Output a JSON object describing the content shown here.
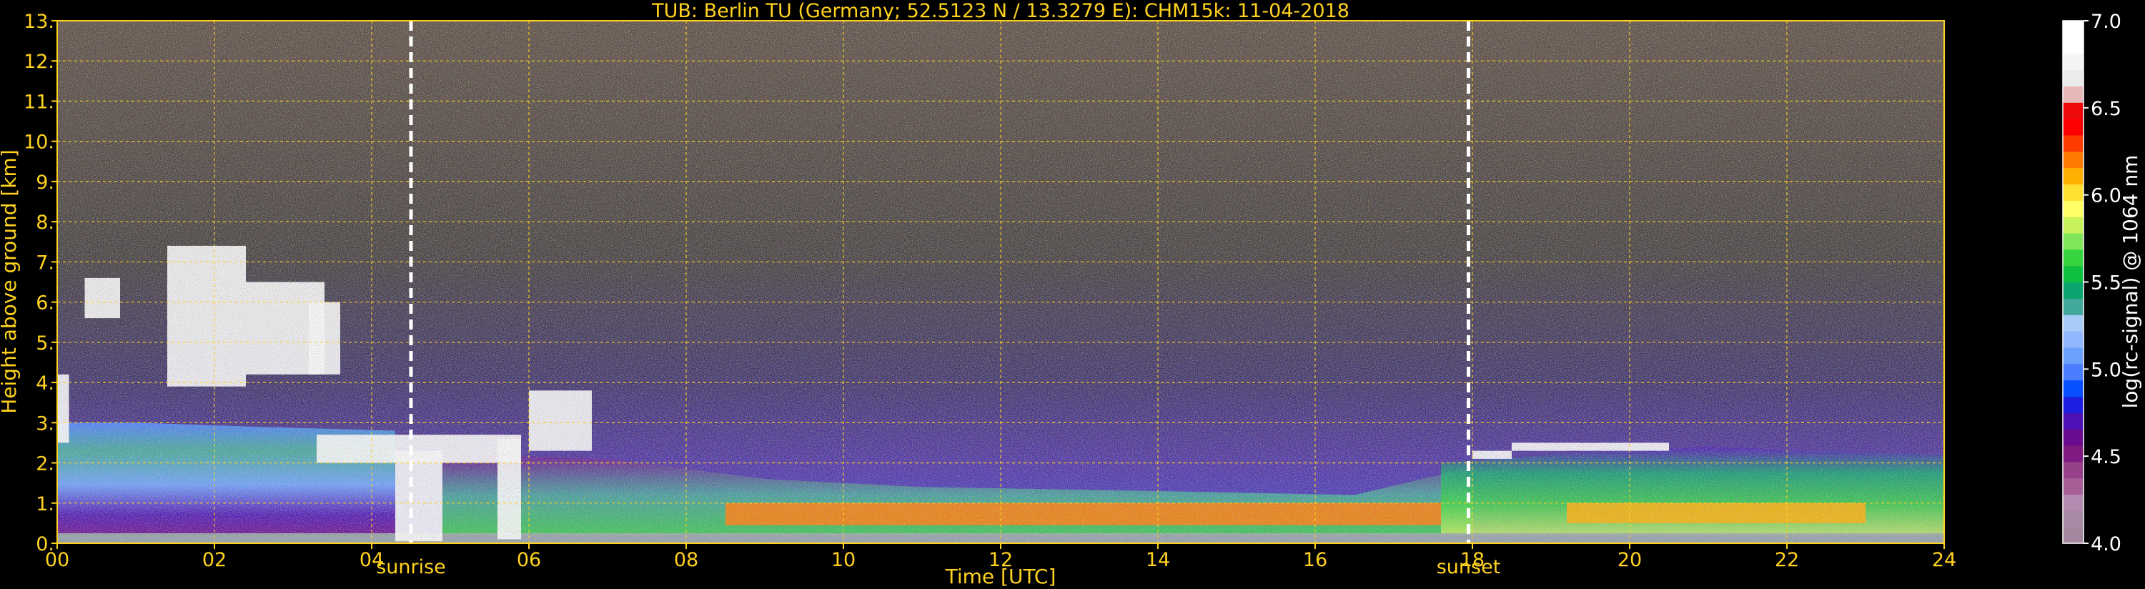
{
  "chart_data": {
    "type": "heatmap",
    "title": "TUB: Berlin TU (Germany; 52.5123 N / 13.3279 E):    CHM15k: 11-04-2018",
    "xlabel": "Time [UTC]",
    "ylabel": "Height above ground [km]",
    "colorbar_label": "log(rc-signal) @ 1064 nm",
    "xlim": [
      0,
      24
    ],
    "ylim": [
      0,
      13
    ],
    "x_ticks": [
      {
        "value": 0,
        "label": "00"
      },
      {
        "value": 2,
        "label": "02"
      },
      {
        "value": 4,
        "label": "04"
      },
      {
        "value": 6,
        "label": "06"
      },
      {
        "value": 8,
        "label": "08"
      },
      {
        "value": 10,
        "label": "10"
      },
      {
        "value": 12,
        "label": "12"
      },
      {
        "value": 14,
        "label": "14"
      },
      {
        "value": 16,
        "label": "16"
      },
      {
        "value": 18,
        "label": "18"
      },
      {
        "value": 20,
        "label": "20"
      },
      {
        "value": 22,
        "label": "22"
      },
      {
        "value": 24,
        "label": "24"
      }
    ],
    "y_ticks": [
      {
        "value": 0,
        "label": "0."
      },
      {
        "value": 1,
        "label": "1."
      },
      {
        "value": 2,
        "label": "2."
      },
      {
        "value": 3,
        "label": "3."
      },
      {
        "value": 4,
        "label": "4."
      },
      {
        "value": 5,
        "label": "5."
      },
      {
        "value": 6,
        "label": "6."
      },
      {
        "value": 7,
        "label": "7."
      },
      {
        "value": 8,
        "label": "8."
      },
      {
        "value": 9,
        "label": "9."
      },
      {
        "value": 10,
        "label": "10."
      },
      {
        "value": 11,
        "label": "11."
      },
      {
        "value": 12,
        "label": "12."
      },
      {
        "value": 13,
        "label": "13."
      }
    ],
    "grid": true,
    "annotations": [
      {
        "label": "sunrise",
        "x": 4.5
      },
      {
        "label": "sunset",
        "x": 17.95
      }
    ],
    "colorbar": {
      "range": [
        4.0,
        7.0
      ],
      "ticks": [
        {
          "value": 4.0,
          "label": "4.0"
        },
        {
          "value": 4.5,
          "label": "4.5"
        },
        {
          "value": 5.0,
          "label": "5.0"
        },
        {
          "value": 5.5,
          "label": "5.5"
        },
        {
          "value": 6.0,
          "label": "6.0"
        },
        {
          "value": 6.5,
          "label": "6.5"
        },
        {
          "value": 7.0,
          "label": "7.0"
        }
      ],
      "colors": [
        "#a4869f",
        "#a88aa4",
        "#b48ab0",
        "#a55f95",
        "#96418a",
        "#7f1a80",
        "#6b0b8f",
        "#4d11b5",
        "#1e1ee0",
        "#0850ff",
        "#4a7dff",
        "#6ba0ff",
        "#8fb8ff",
        "#a8ccf5",
        "#41a89a",
        "#0aa56e",
        "#0fbf3e",
        "#35d63d",
        "#7fe65a",
        "#c8f25c",
        "#ffff66",
        "#ffe030",
        "#ffb000",
        "#ff7a00",
        "#ff3c00",
        "#ff0000",
        "#ee0a0a",
        "#e8b8b8",
        "#ebebeb",
        "#f4f4f4",
        "#ffffff",
        "#ffffff"
      ]
    },
    "layers": [
      {
        "t0": 0,
        "t1": 24,
        "h0": 0,
        "h1": 0.25,
        "color": "#9aa8a6"
      },
      {
        "t0": 0,
        "t1": 0.15,
        "h0": 2.5,
        "h1": 4.2,
        "color": "#ffffff"
      },
      {
        "t0": 0.35,
        "t1": 0.8,
        "h0": 5.6,
        "h1": 6.6,
        "color": "#ffffff"
      },
      {
        "t0": 1.4,
        "t1": 2.4,
        "h0": 3.9,
        "h1": 7.4,
        "color": "#ffffff"
      },
      {
        "t0": 2.4,
        "t1": 3.4,
        "h0": 4.2,
        "h1": 6.5,
        "color": "#ffffff"
      },
      {
        "t0": 3.2,
        "t1": 3.6,
        "h0": 4.2,
        "h1": 6.0,
        "color": "#ffffff"
      },
      {
        "t0": 3.3,
        "t1": 5.9,
        "h0": 2.0,
        "h1": 2.7,
        "color": "#ffffff"
      },
      {
        "t0": 4.3,
        "t1": 4.9,
        "h0": 0.05,
        "h1": 2.3,
        "color": "#ffffff"
      },
      {
        "t0": 5.6,
        "t1": 5.9,
        "h0": 0.1,
        "h1": 2.6,
        "color": "#ffffff"
      },
      {
        "t0": 6.0,
        "t1": 6.8,
        "h0": 2.3,
        "h1": 3.8,
        "color": "#ffffff"
      },
      {
        "t0": 18.0,
        "t1": 18.5,
        "h0": 2.1,
        "h1": 2.3,
        "color": "#ffffff"
      },
      {
        "t0": 18.5,
        "t1": 20.5,
        "h0": 2.3,
        "h1": 2.5,
        "color": "#ffffff"
      },
      {
        "t0": 8.5,
        "t1": 17.6,
        "h0": 0.45,
        "h1": 1.0,
        "color": "#ff7a00"
      },
      {
        "t0": 19.2,
        "t1": 23.0,
        "h0": 0.5,
        "h1": 1.0,
        "color": "#ffb000"
      }
    ]
  }
}
